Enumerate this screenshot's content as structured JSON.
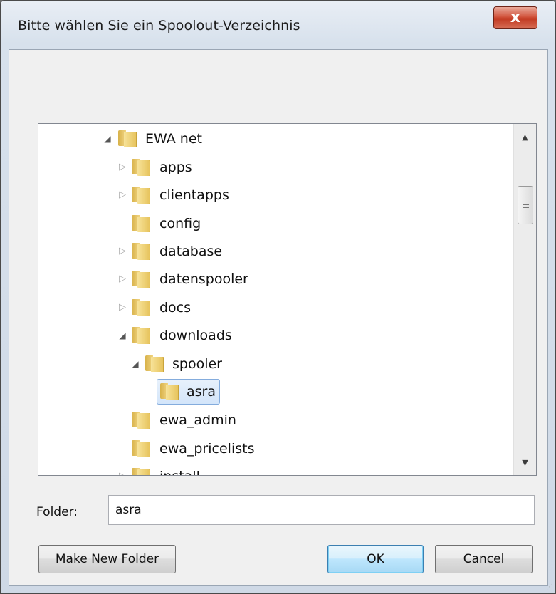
{
  "window": {
    "title": "Bitte wählen Sie ein Spoolout-Verzeichnis",
    "close_glyph": "x"
  },
  "tree": {
    "items": [
      {
        "label": "EWA net",
        "expander": "expanded"
      },
      {
        "label": "apps",
        "expander": "collapsed"
      },
      {
        "label": "clientapps",
        "expander": "collapsed"
      },
      {
        "label": "config",
        "expander": "none"
      },
      {
        "label": "database",
        "expander": "collapsed"
      },
      {
        "label": "datenspooler",
        "expander": "collapsed"
      },
      {
        "label": "docs",
        "expander": "collapsed"
      },
      {
        "label": "downloads",
        "expander": "expanded"
      },
      {
        "label": "spooler",
        "expander": "expanded"
      },
      {
        "label": "asra",
        "expander": "none",
        "selected": true
      },
      {
        "label": "ewa_admin",
        "expander": "none"
      },
      {
        "label": "ewa_pricelists",
        "expander": "none"
      },
      {
        "label": "install",
        "expander": "collapsed"
      }
    ],
    "glyphs": {
      "expanded": "◢",
      "collapsed": "▷",
      "scroll_up": "▲",
      "scroll_down": "▼"
    }
  },
  "folder": {
    "label": "Folder:",
    "value": "asra"
  },
  "buttons": {
    "make_new_folder": "Make New Folder",
    "ok": "OK",
    "cancel": "Cancel"
  },
  "colors": {
    "selection_border": "#84acdd",
    "close_button": "#c23a22",
    "folder_icon": "#f1d583"
  }
}
